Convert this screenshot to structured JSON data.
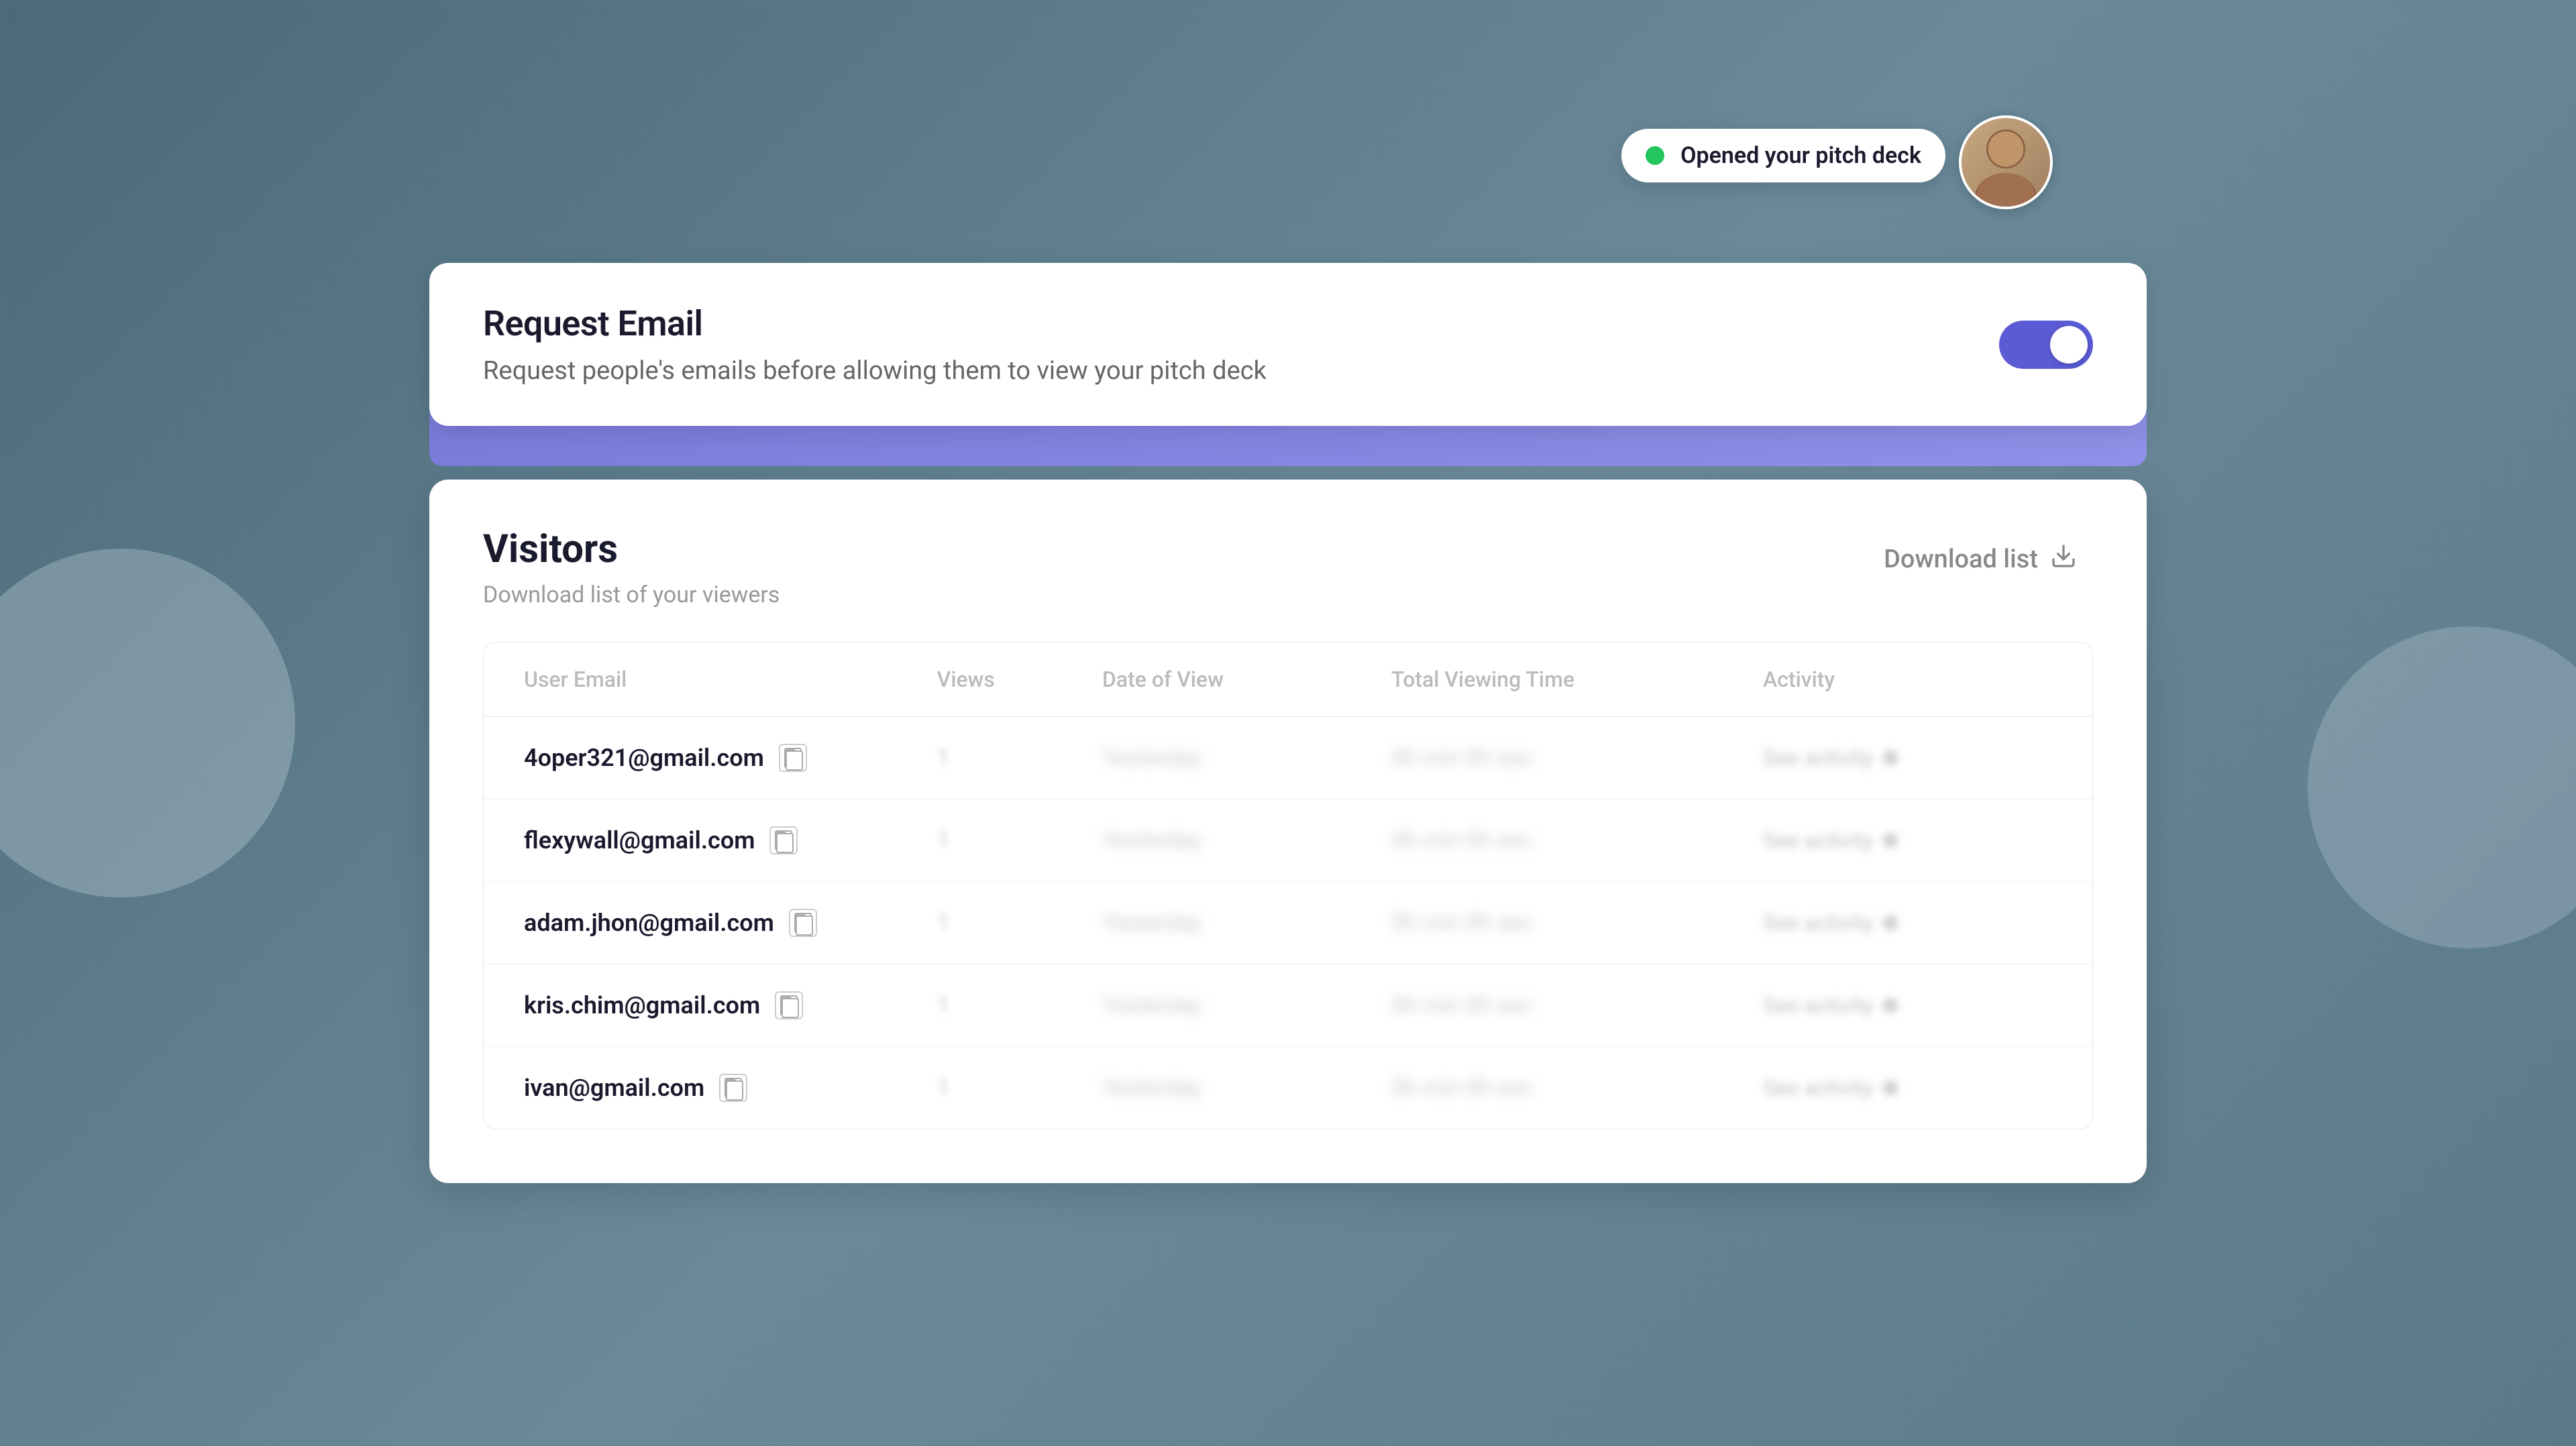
{
  "background": {
    "color": "#5a7a8a"
  },
  "requestEmailCard": {
    "title": "Request Email",
    "description": "Request people's emails before allowing them to view your pitch deck",
    "toggle": {
      "enabled": true,
      "ariaLabel": "Toggle request email"
    }
  },
  "notification": {
    "text": "Opened your pitch deck",
    "status": "online"
  },
  "visitorsCard": {
    "title": "Visitors",
    "subtitle": "Download list of your viewers",
    "downloadButton": "Download list",
    "table": {
      "headers": {
        "email": "User Email",
        "views": "Views",
        "dateOfView": "Date of View",
        "totalViewingTime": "Total Viewing Time",
        "activity": "Activity"
      },
      "rows": [
        {
          "email": "4oper321@gmail.com",
          "views": "1",
          "dateOfView": "Yesterday",
          "totalViewingTime": "0h min 0h sec",
          "activity": "See activity"
        },
        {
          "email": "flexywall@gmail.com",
          "views": "1",
          "dateOfView": "Yesterday",
          "totalViewingTime": "0h min 0h sec",
          "activity": "See activity"
        },
        {
          "email": "adam.jhon@gmail.com",
          "views": "1",
          "dateOfView": "Yesterday",
          "totalViewingTime": "0h min 0h sec",
          "activity": "See activity"
        },
        {
          "email": "kris.chim@gmail.com",
          "views": "1",
          "dateOfView": "Yesterday",
          "totalViewingTime": "0h min 0h sec",
          "activity": "See activity"
        },
        {
          "email": "ivan@gmail.com",
          "views": "1",
          "dateOfView": "Yesterday",
          "totalViewingTime": "0h min 0h sec",
          "activity": "See activity"
        }
      ]
    }
  },
  "colors": {
    "accent": "#5b5bd6",
    "green": "#22c55e",
    "text_primary": "#1a1a2e",
    "text_muted": "#999999",
    "border": "#e8e8e8"
  }
}
